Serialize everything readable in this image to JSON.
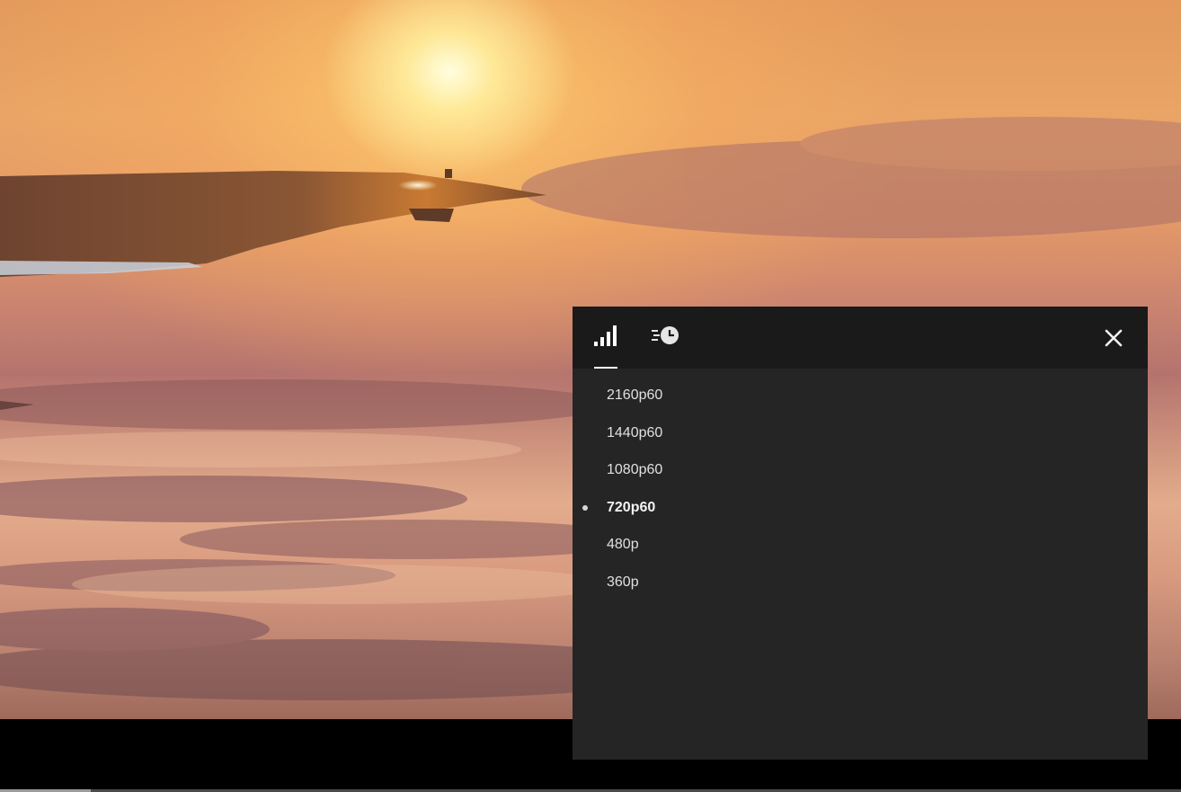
{
  "player": {
    "progress_fraction": 0.077,
    "colors": {
      "panel_background": "#252525",
      "panel_header": "#1a1a1a",
      "text": "#e0e0e0",
      "accent": "#ffffff"
    }
  },
  "settings_panel": {
    "tabs": [
      {
        "name": "quality",
        "icon": "signal-bars-icon",
        "active": true
      },
      {
        "name": "playback-speed",
        "icon": "speed-clock-icon",
        "active": false
      }
    ],
    "close_icon": "close-icon",
    "quality_options": [
      {
        "label": "2160p60",
        "selected": false
      },
      {
        "label": "1440p60",
        "selected": false
      },
      {
        "label": "1080p60",
        "selected": false
      },
      {
        "label": "720p60",
        "selected": true
      },
      {
        "label": "480p",
        "selected": false
      },
      {
        "label": "360p",
        "selected": false
      }
    ]
  }
}
